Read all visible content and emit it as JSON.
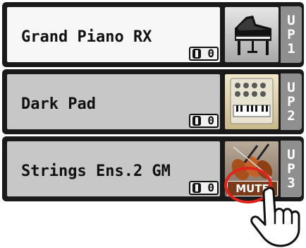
{
  "parts": [
    {
      "name": "Grand Piano RX",
      "octave": "0",
      "part_label": [
        "U",
        "P",
        "1"
      ],
      "icon": "grand-piano-icon",
      "selected": true,
      "muted": false
    },
    {
      "name": "Dark Pad",
      "octave": "0",
      "part_label": [
        "U",
        "P",
        "2"
      ],
      "icon": "pad-keyboard-icon",
      "selected": false,
      "muted": false
    },
    {
      "name": "Strings Ens.2 GM",
      "octave": "0",
      "part_label": [
        "U",
        "P",
        "3"
      ],
      "icon": "violins-icon",
      "selected": false,
      "muted": true,
      "mute_label": "MUTE"
    }
  ],
  "colors": {
    "panel": "#1a1a1a",
    "selected_bg": "#f7f7f7",
    "unselected_bg": "#c7c7c7",
    "part_label_bg": "#8f8f8f",
    "mute_bg": "#7a3b1a",
    "highlight_ring": "#e0241b"
  }
}
